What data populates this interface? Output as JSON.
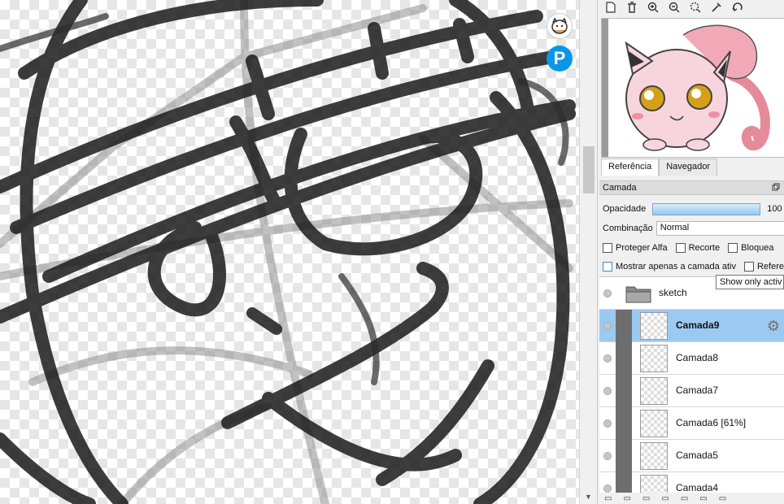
{
  "top_toolbar": {
    "icons": [
      "new-page-icon",
      "delete-icon",
      "zoom-in-icon",
      "zoom-out-icon",
      "zoom-fit-icon",
      "eyedropper-icon",
      "rotate-icon"
    ]
  },
  "reference_panel": {
    "tabs": [
      {
        "label": "Referência",
        "active": true
      },
      {
        "label": "Navegador",
        "active": false
      }
    ]
  },
  "layer_panel": {
    "title": "Camada",
    "opacity_label": "Opacidade",
    "opacity_value": "100",
    "opacity_fraction": 1.0,
    "blend_label": "Combinação",
    "blend_value": "Normal",
    "checkboxes_row1": [
      {
        "label": "Proteger Alfa",
        "checked": false
      },
      {
        "label": "Recorte",
        "checked": false
      },
      {
        "label": "Bloquea",
        "checked": false
      }
    ],
    "checkboxes_row2": [
      {
        "label": "Mostrar apenas a camada ativ",
        "checked": false
      },
      {
        "label": "Referer",
        "checked": false
      }
    ],
    "tooltip": "Show only activ",
    "folder": {
      "name": "sketch"
    },
    "layers": [
      {
        "name": "Camada9",
        "selected": true
      },
      {
        "name": "Camada8",
        "selected": false
      },
      {
        "name": "Camada7",
        "selected": false
      },
      {
        "name": "Camada6 [61%]",
        "selected": false
      },
      {
        "name": "Camada5",
        "selected": false
      },
      {
        "name": "Camada4",
        "selected": false
      }
    ]
  },
  "canvas": {
    "floating_buttons": [
      "mascot-icon",
      "pixiv-icon"
    ],
    "pixiv_letter": "P"
  },
  "colors": {
    "selection": "#9cc9f1",
    "opacity_bar": "#97c9ee",
    "stroke": "#1c1c1c"
  }
}
